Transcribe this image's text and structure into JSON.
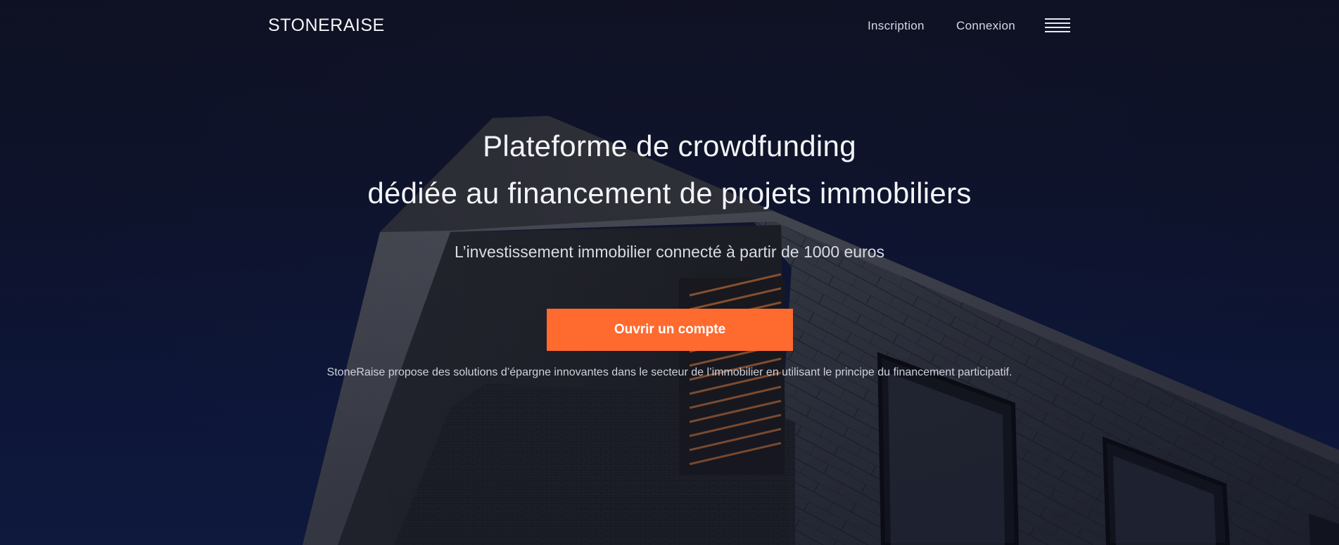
{
  "nav": {
    "brand": "STONERAISE",
    "links": [
      {
        "label": "Inscription"
      },
      {
        "label": "Connexion"
      }
    ],
    "menu_icon": "hamburger-menu-icon"
  },
  "hero": {
    "headline_line1": "Plateforme de crowdfunding",
    "headline_line2": "dédiée au financement de projets immobiliers",
    "subheadline": "L’investissement immobilier connecté à partir de 1000 euros",
    "cta_label": "Ouvrir un compte",
    "description": "StoneRaise propose des solutions d’épargne innovantes dans le secteur de l’immobilier en utilisant le principe du financement participatif."
  },
  "colors": {
    "accent": "#ff6a2f",
    "background": "#101631"
  }
}
